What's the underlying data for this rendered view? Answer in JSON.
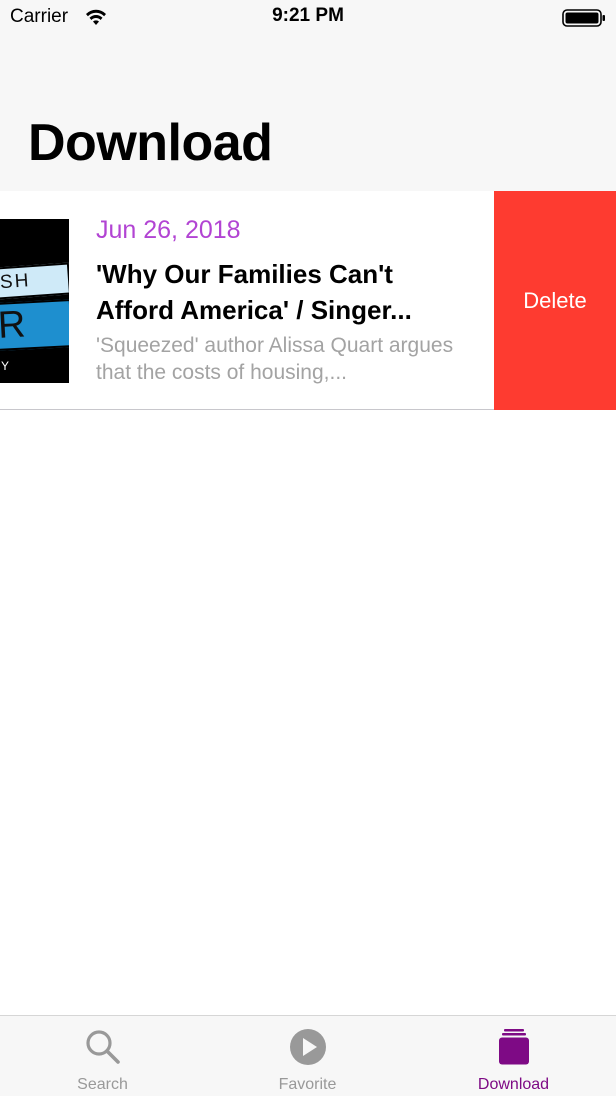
{
  "status_bar": {
    "carrier": "Carrier",
    "time": "9:21 PM",
    "wifi_icon": "wifi-icon",
    "battery_icon": "battery-icon"
  },
  "header": {
    "title": "Download"
  },
  "list": {
    "items": [
      {
        "date": "Jun 26, 2018",
        "title": "'Why Our Families Can't Afford America' / Singer...",
        "description": "'Squeezed' author Alissa Quart argues that the costs of housing,...",
        "thumbnail_text_top": "SH",
        "thumbnail_text_bottom": "R",
        "thumbnail_text_small": "Y",
        "delete_label": "Delete"
      }
    ]
  },
  "tab_bar": {
    "tabs": [
      {
        "label": "Search",
        "icon": "search-icon",
        "active": false
      },
      {
        "label": "Favorite",
        "icon": "play-circle-icon",
        "active": false
      },
      {
        "label": "Download",
        "icon": "download-stack-icon",
        "active": true
      }
    ]
  },
  "colors": {
    "accent": "#7e0a85",
    "date": "#b244d3",
    "delete": "#fe3b30",
    "inactive_tab": "#999999"
  }
}
